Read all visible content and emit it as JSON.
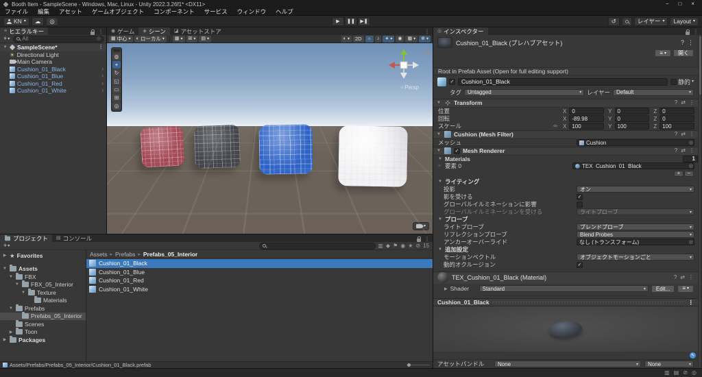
{
  "title_bar": {
    "app_title": "Booth Item - SampleScene - Windows, Mac, Linux - Unity 2022.3.26f1* <DX11>"
  },
  "menu": {
    "items": [
      "ファイル",
      "編集",
      "アセット",
      "ゲームオブジェクト",
      "コンポーネント",
      "サービス",
      "ウィンドウ",
      "ヘルプ"
    ]
  },
  "toolbar": {
    "account_label": "KN",
    "layers_label": "レイヤー",
    "layout_label": "Layout"
  },
  "hierarchy": {
    "tab_label": "ヒエラルキー",
    "search_value": "All",
    "scene_name": "SampleScene*",
    "items": [
      {
        "name": "Directional Light",
        "type": "light"
      },
      {
        "name": "Main Camera",
        "type": "camera"
      },
      {
        "name": "Cushion_01_Black",
        "type": "prefab"
      },
      {
        "name": "Cushion_01_Blue",
        "type": "prefab"
      },
      {
        "name": "Cushion_01_Red",
        "type": "prefab"
      },
      {
        "name": "Cushion_01_White",
        "type": "prefab"
      }
    ]
  },
  "scene_panel": {
    "tabs": [
      {
        "label": "ゲーム"
      },
      {
        "label": "シーン"
      },
      {
        "label": "アセットストア"
      }
    ],
    "toolbar": {
      "pivot_label": "中心",
      "space_label": "ローカル",
      "mode_2d": "2D"
    },
    "gizmo_label": "Persp"
  },
  "inspector": {
    "tab_label": "インスペクター",
    "header": {
      "title": "Cushion_01_Black (プレハブアセット)",
      "open_button": "開く"
    },
    "root_note": "Root in Prefab Asset (Open for full editing support)",
    "game_object": {
      "name": "Cushion_01_Black",
      "static_label": "静的",
      "tag_label": "タグ",
      "tag_value": "Untagged",
      "layer_label": "レイヤー",
      "layer_value": "Default"
    },
    "transform": {
      "title": "Transform",
      "position_label": "位置",
      "rotation_label": "回転",
      "scale_label": "スケール",
      "axis": {
        "x": "X",
        "y": "Y",
        "z": "Z"
      },
      "position": {
        "x": "0",
        "y": "0",
        "z": "0"
      },
      "rotation": {
        "x": "-89.98",
        "y": "0",
        "z": "0"
      },
      "scale": {
        "x": "100",
        "y": "100",
        "z": "100"
      }
    },
    "mesh_filter": {
      "title": "Cushion (Mesh Filter)",
      "mesh_label": "メッシュ",
      "mesh_value": "Cushion"
    },
    "mesh_renderer": {
      "title": "Mesh Renderer",
      "materials_label": "Materials",
      "materials_count": "1",
      "element_label": "要素 0",
      "element_value": "TEX_Cushion_01_Black"
    },
    "lighting": {
      "title": "ライティング",
      "cast_shadows_label": "投影",
      "cast_shadows_value": "オン",
      "receive_shadows_label": "影を受ける",
      "contribute_gi_label": "グローバルイルミネーションに影響",
      "receive_gi_label": "グローバルイルミネーションを受ける",
      "receive_gi_value": "ライトプローブ"
    },
    "probes": {
      "title": "プローブ",
      "light_probes_label": "ライトプローブ",
      "light_probes_value": "ブレンドプローブ",
      "reflection_probes_label": "リフレクションプローブ",
      "reflection_probes_value": "Blend Probes",
      "anchor_label": "アンカーオーバーライド",
      "anchor_value": "なし (トランスフォーム)"
    },
    "additional": {
      "title": "追加設定",
      "motion_vectors_label": "モーションベクトル",
      "motion_vectors_value": "オブジェクトモーションごと",
      "dynamic_occlusion_label": "動的オクルージョン"
    },
    "material": {
      "title": "TEX_Cushion_01_Black (Material)",
      "shader_label": "Shader",
      "shader_value": "Standard",
      "edit_button": "Edit...",
      "preview_title": "Cushion_01_Black"
    },
    "asset_bundle": {
      "label": "アセットバンドル",
      "bundle_value": "None",
      "variant_value": "None"
    }
  },
  "project": {
    "tab_label": "プロジェクト",
    "console_tab_label": "コンソール",
    "favorites_label": "Favorites",
    "tree": [
      {
        "label": "Assets",
        "depth": 0,
        "fold": "open"
      },
      {
        "label": "FBX",
        "depth": 1,
        "fold": "open"
      },
      {
        "label": "FBX_05_Interior",
        "depth": 2,
        "fold": "open"
      },
      {
        "label": "Texture",
        "depth": 3,
        "fold": "open"
      },
      {
        "label": "Materials",
        "depth": 4,
        "fold": "none"
      },
      {
        "label": "Prefabs",
        "depth": 1,
        "fold": "open"
      },
      {
        "label": "Prefabs_05_Interior",
        "depth": 2,
        "fold": "none",
        "selected": true
      },
      {
        "label": "Scenes",
        "depth": 1,
        "fold": "none"
      },
      {
        "label": "Toon",
        "depth": 1,
        "fold": "closed"
      },
      {
        "label": "Packages",
        "depth": 0,
        "fold": "closed"
      }
    ],
    "breadcrumb": [
      "Assets",
      "Prefabs",
      "Prefabs_05_Interior"
    ],
    "files": [
      {
        "name": "Cushion_01_Black",
        "selected": true
      },
      {
        "name": "Cushion_01_Blue"
      },
      {
        "name": "Cushion_01_Red"
      },
      {
        "name": "Cushion_01_White"
      }
    ],
    "hidden_count": "15",
    "selected_path": "Assets/Prefabs/Prefabs_05_Interior/Cushion_01_Black.prefab"
  },
  "colors": {
    "selection_blue": "#3a79bb",
    "prefab_text_blue": "#8ab4e8",
    "active_tool_blue": "#3d6091",
    "sky_top": "#6f90b6",
    "ground": "#6b6158"
  }
}
